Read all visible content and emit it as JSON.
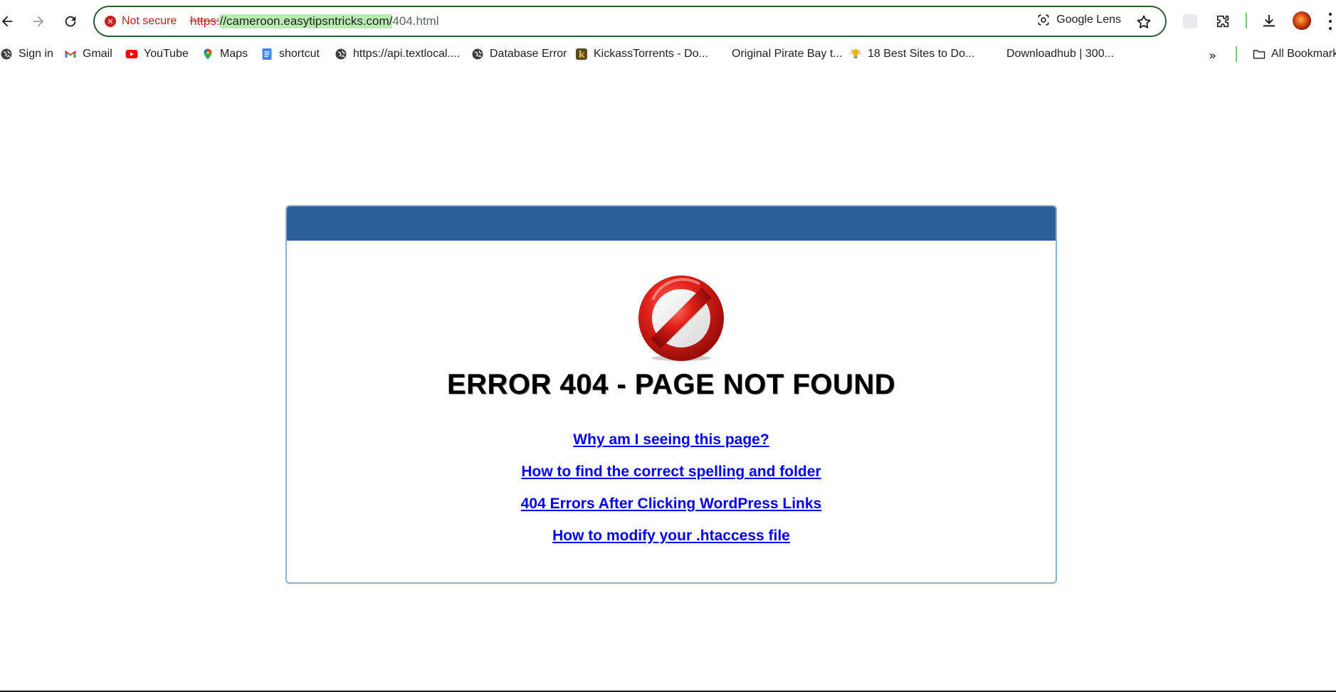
{
  "toolbar": {
    "security_label": "Not secure",
    "url_scheme": "https:",
    "url_host": "//cameroon.easytipsntricks.com/",
    "url_path": "404.html",
    "lens_label": "Google Lens"
  },
  "bookmarks": [
    {
      "label": "Sign in",
      "icon": "globe-icon"
    },
    {
      "label": "Gmail",
      "icon": "gmail-icon"
    },
    {
      "label": "YouTube",
      "icon": "youtube-icon"
    },
    {
      "label": "Maps",
      "icon": "maps-icon"
    },
    {
      "label": "shortcut",
      "icon": "docs-icon"
    },
    {
      "label": "https://api.textlocal....",
      "icon": "globe-icon"
    },
    {
      "label": "Database Error",
      "icon": "globe-icon"
    },
    {
      "label": "KickassTorrents - Do...",
      "icon": "kickass-icon"
    },
    {
      "label": "Original Pirate Bay t...",
      "icon": "blank-icon"
    },
    {
      "label": "18 Best Sites to Do...",
      "icon": "bulb-icon"
    },
    {
      "label": "Downloadhub | 300...",
      "icon": "blank-icon"
    }
  ],
  "all_bookmarks_label": "All Bookmarks",
  "colors": {
    "header_blue": "#2b5f9b",
    "link_blue": "#0000ee",
    "omnibox_border": "#2e5a2e",
    "not_secure_red": "#c5221f"
  },
  "error": {
    "title": "ERROR 404 - PAGE NOT FOUND",
    "links": [
      "Why am I seeing this page?",
      "How to find the correct spelling and folder",
      "404 Errors After Clicking WordPress Links",
      "How to modify your .htaccess file"
    ]
  }
}
